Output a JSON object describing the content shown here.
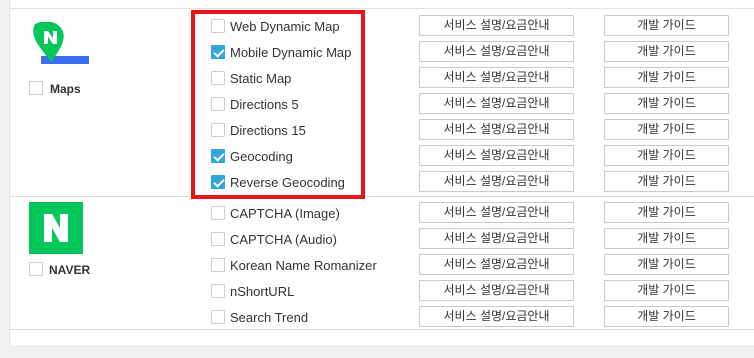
{
  "products": [
    {
      "name": "Maps",
      "icon": "naver-maps-icon",
      "checked": false,
      "services": [
        {
          "label": "Web Dynamic Map",
          "checked": false
        },
        {
          "label": "Mobile Dynamic Map",
          "checked": true
        },
        {
          "label": "Static Map",
          "checked": false
        },
        {
          "label": "Directions 5",
          "checked": false
        },
        {
          "label": "Directions 15",
          "checked": false
        },
        {
          "label": "Geocoding",
          "checked": true
        },
        {
          "label": "Reverse Geocoding",
          "checked": true
        }
      ]
    },
    {
      "name": "NAVER",
      "icon": "naver-logo-icon",
      "checked": false,
      "services": [
        {
          "label": "CAPTCHA (Image)",
          "checked": false
        },
        {
          "label": "CAPTCHA (Audio)",
          "checked": false
        },
        {
          "label": "Korean Name Romanizer",
          "checked": false
        },
        {
          "label": "nShortURL",
          "checked": false
        },
        {
          "label": "Search Trend",
          "checked": false
        }
      ]
    }
  ],
  "buttons": {
    "description_label": "서비스 설명/요금안내",
    "guide_label": "개발 가이드"
  },
  "colors": {
    "checkbox_checked": "#2ea8dc",
    "highlight_border": "#e8141b",
    "naver_green": "#03c75a",
    "maps_blue": "#3b6ff0"
  }
}
